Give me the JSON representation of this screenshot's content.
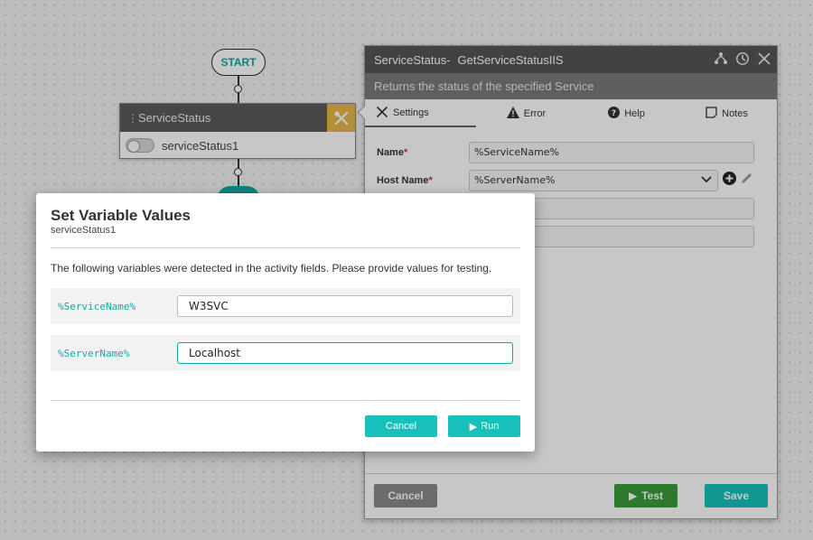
{
  "canvas": {
    "start_label": "START",
    "activity": {
      "title": "ServiceStatus",
      "instance_name": "serviceStatus1"
    }
  },
  "panel": {
    "title_prefix": "ServiceStatus-",
    "title_activity": "GetServiceStatusIIS",
    "subtitle": "Returns the status of the specified Service",
    "tabs": [
      {
        "label": "Settings",
        "icon": "tools-icon",
        "active": true
      },
      {
        "label": "Error",
        "icon": "warning-icon",
        "active": false
      },
      {
        "label": "Help",
        "icon": "question-icon",
        "active": false
      },
      {
        "label": "Notes",
        "icon": "note-icon",
        "active": false
      }
    ],
    "fields": {
      "name_label": "Name",
      "name_value": "%ServiceName%",
      "host_label": "Host Name",
      "host_value": "%ServerName%"
    },
    "footer": {
      "cancel": "Cancel",
      "test": "Test",
      "save": "Save"
    }
  },
  "modal": {
    "title": "Set Variable Values",
    "subtitle": "serviceStatus1",
    "description": "The following variables were detected in the activity fields. Please provide values for testing.",
    "variables": [
      {
        "name": "%ServiceName%",
        "value": "W3SVC"
      },
      {
        "name": "%ServerName%",
        "value": "Localhost"
      }
    ],
    "cancel_label": "Cancel",
    "run_label": "Run"
  },
  "colors": {
    "accent": "#14a7a1",
    "button_teal": "#17c0bb",
    "test_green": "#3a9b3a",
    "tool_yellow": "#e8b74a"
  }
}
